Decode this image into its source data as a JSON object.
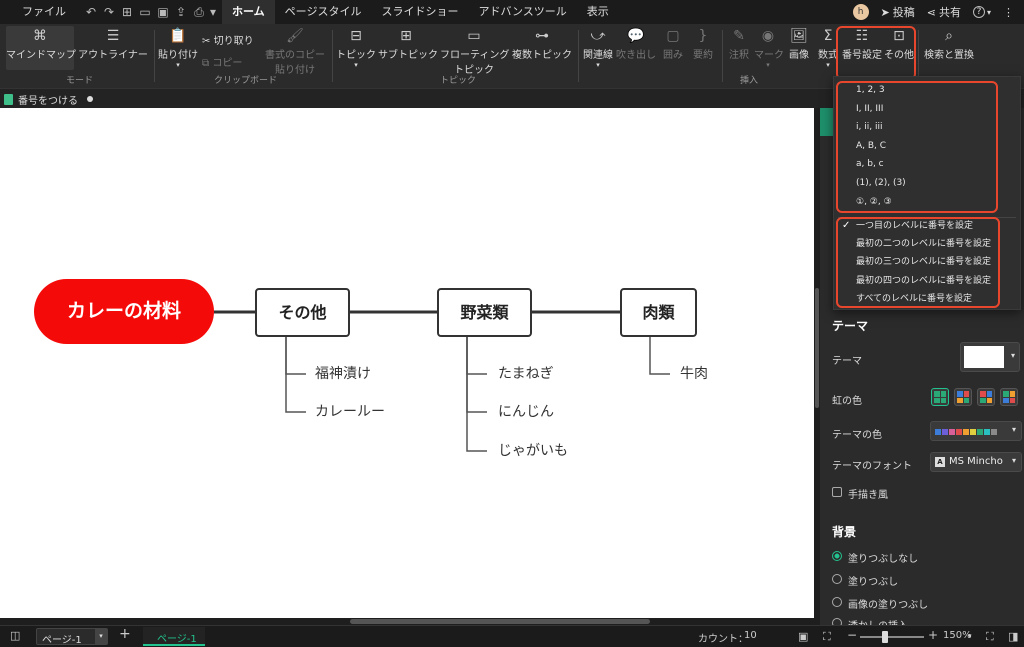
{
  "menubar": {
    "file": "ファイル",
    "tabs": [
      "ホーム",
      "ページスタイル",
      "スライドショー",
      "アドバンスツール",
      "表示"
    ],
    "avatar": "h",
    "publish": "投稿",
    "share": "共有",
    "help": "?"
  },
  "ribbon": {
    "mode": {
      "mindmap": "マインドマップ",
      "outliner": "アウトライナー",
      "group": "モード"
    },
    "clipboard": {
      "paste": "貼り付け",
      "cut": "切り取り",
      "copy": "コピー",
      "format_copy_1": "書式のコピー",
      "format_copy_2": "貼り付け",
      "group": "クリップボード"
    },
    "topic": {
      "topic": "トピック",
      "subtopic": "サブトピック",
      "floating_1": "フローティング",
      "floating_2": "トピック",
      "multi": "複数トピック",
      "group": "トピック"
    },
    "insert": {
      "relation": "関連線",
      "callout": "吹き出し",
      "boundary": "囲み",
      "summary": "要約",
      "note": "注釈",
      "mark": "マーク",
      "image": "画像",
      "formula": "数式",
      "numbering": "番号設定",
      "other": "その他",
      "group": "挿入"
    },
    "search": {
      "label": "検索と置換"
    }
  },
  "doctab": {
    "title": "番号をつける"
  },
  "mindmap": {
    "main": "カレーの材料",
    "topics": [
      {
        "label": "その他",
        "subs": [
          "福神漬け",
          "カレールー"
        ]
      },
      {
        "label": "野菜類",
        "subs": [
          "たまねぎ",
          "にんじん",
          "じゃがいも"
        ]
      },
      {
        "label": "肉類",
        "subs": [
          "牛肉"
        ]
      }
    ]
  },
  "dropdown": {
    "formats": [
      "1, 2, 3",
      "I, II, III",
      "i, ii, iii",
      "A, B, C",
      "a, b, c",
      "(1), (2), (3)",
      "①, ②, ③"
    ],
    "levels": [
      "一つ目のレベルに番号を設定",
      "最初の二つのレベルに番号を設定",
      "最初の三つのレベルに番号を設定",
      "最初の四つのレベルに番号を設定",
      "すべてのレベルに番号を設定"
    ],
    "checked_index": 0
  },
  "panel": {
    "theme_header": "テーマ",
    "theme_label": "テーマ",
    "rainbow_label": "虹の色",
    "theme_color_label": "テーマの色",
    "theme_font_label": "テーマのフォント",
    "theme_font_value": "MS Mincho",
    "handdrawn": "手描き風",
    "background_header": "背景",
    "bg_options": [
      "塗りつぶしなし",
      "塗りつぶし",
      "画像の塗りつぶし",
      "透かしの挿入"
    ]
  },
  "statusbar": {
    "page_select": "ページ-1",
    "page_tab": "ページ-1",
    "count_label": "カウント：",
    "count_value": "10",
    "zoom": "150%"
  },
  "colors": {
    "accent": "#22c38e",
    "highlight": "#e8472e",
    "main_topic": "#f50a0a"
  }
}
